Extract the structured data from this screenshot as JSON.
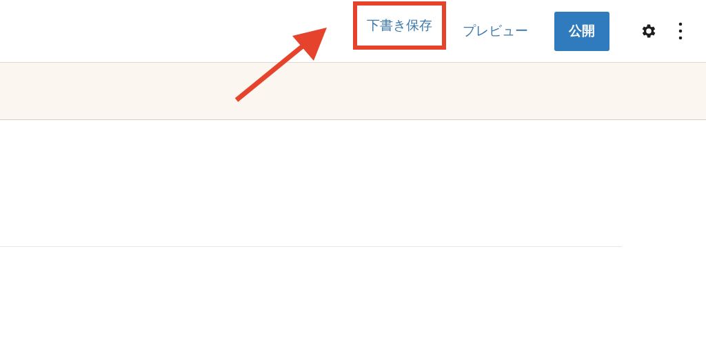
{
  "toolbar": {
    "buttons": [
      {
        "kind": "link",
        "label": "下書き保存",
        "highlighted": true
      },
      {
        "kind": "link",
        "label": "プレビュー"
      },
      {
        "kind": "primary",
        "label": "公開"
      }
    ],
    "icons": [
      {
        "kind": "settings"
      },
      {
        "kind": "more"
      }
    ]
  },
  "annotation": {
    "kind": "arrow"
  }
}
